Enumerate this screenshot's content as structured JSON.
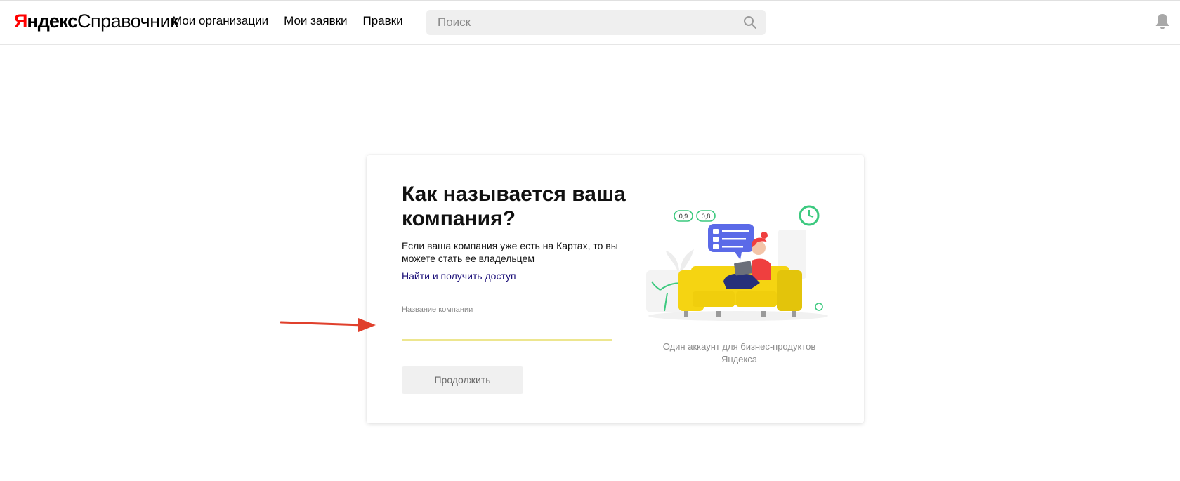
{
  "header": {
    "logo": {
      "brand_first": "Я",
      "brand_rest": "ндекс",
      "product": "Справочник"
    },
    "nav": [
      {
        "label": "Мои организации"
      },
      {
        "label": "Мои заявки"
      },
      {
        "label": "Правки"
      }
    ],
    "search": {
      "placeholder": "Поиск",
      "icon": "search-icon"
    },
    "bell_icon": "bell-icon"
  },
  "card": {
    "title": "Как называется ваша компания?",
    "description": "Если ваша компания уже есть на Картах, то вы можете стать ее владельцем",
    "link": "Найти и получить доступ",
    "field": {
      "label": "Название компании",
      "value": ""
    },
    "continue_button": "Продолжить",
    "illustration": {
      "badges": [
        "0,9",
        "0,8"
      ],
      "caption": "Один аккаунт для бизнес-продуктов Яндекса"
    }
  },
  "colors": {
    "accent_yellow": "#f5d412",
    "link_color": "#1a0e78",
    "annotation_arrow": "#e0402c"
  }
}
